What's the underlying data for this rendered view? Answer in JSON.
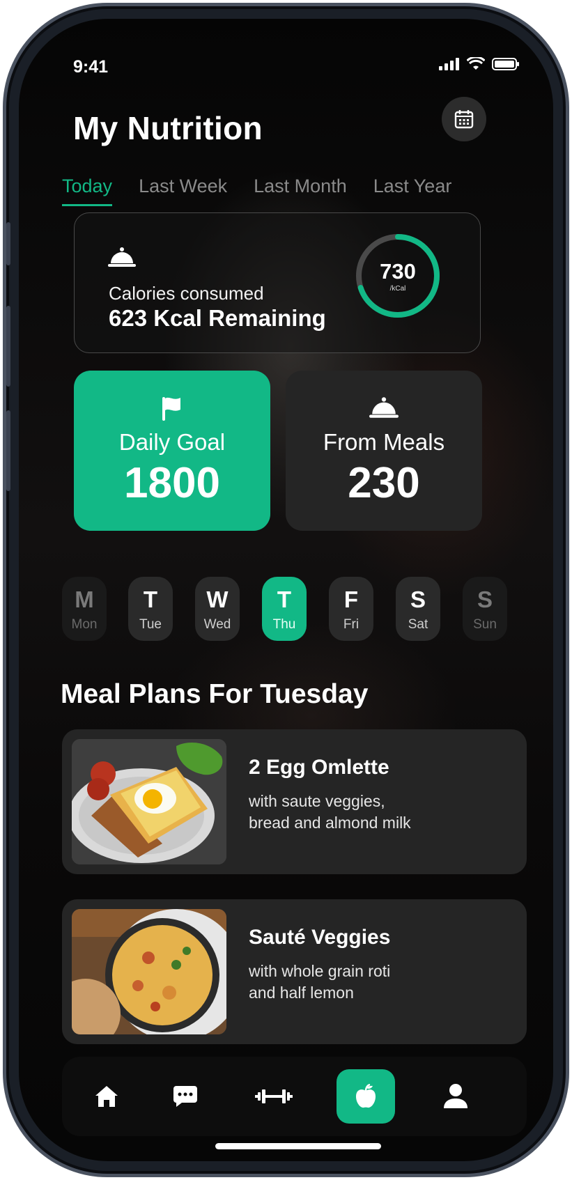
{
  "status": {
    "time": "9:41"
  },
  "header": {
    "title": "My Nutrition"
  },
  "tabs": [
    {
      "label": "Today",
      "active": true
    },
    {
      "label": "Last Week",
      "active": false
    },
    {
      "label": "Last Month",
      "active": false
    },
    {
      "label": "Last Year",
      "active": false
    }
  ],
  "calories": {
    "label": "Calories consumed",
    "remaining": "623 Kcal Remaining",
    "value": "730",
    "unit": "/kCal",
    "progress_fraction": 0.7
  },
  "stats": {
    "goal": {
      "label": "Daily Goal",
      "value": "1800"
    },
    "meals": {
      "label": "From Meals",
      "value": "230"
    }
  },
  "days": [
    {
      "letter": "M",
      "name": "Mon",
      "state": "dim"
    },
    {
      "letter": "T",
      "name": "Tue",
      "state": "normal"
    },
    {
      "letter": "W",
      "name": "Wed",
      "state": "normal"
    },
    {
      "letter": "T",
      "name": "Thu",
      "state": "active"
    },
    {
      "letter": "F",
      "name": "Fri",
      "state": "normal"
    },
    {
      "letter": "S",
      "name": "Sat",
      "state": "normal"
    },
    {
      "letter": "S",
      "name": "Sun",
      "state": "dim"
    }
  ],
  "section_title": "Meal Plans For Tuesday",
  "meals": [
    {
      "name": "2 Egg Omlette",
      "desc_line1": "with saute veggies,",
      "desc_line2": "bread and almond milk"
    },
    {
      "name": "Sauté Veggies",
      "desc_line1": "with whole grain roti",
      "desc_line2": "and half lemon"
    }
  ],
  "nav": [
    {
      "icon": "home-icon"
    },
    {
      "icon": "chat-icon"
    },
    {
      "icon": "dumbbell-icon"
    },
    {
      "icon": "apple-icon",
      "active": true
    },
    {
      "icon": "profile-icon"
    }
  ],
  "colors": {
    "accent": "#12b886",
    "card": "#252525",
    "background": "#000000"
  }
}
